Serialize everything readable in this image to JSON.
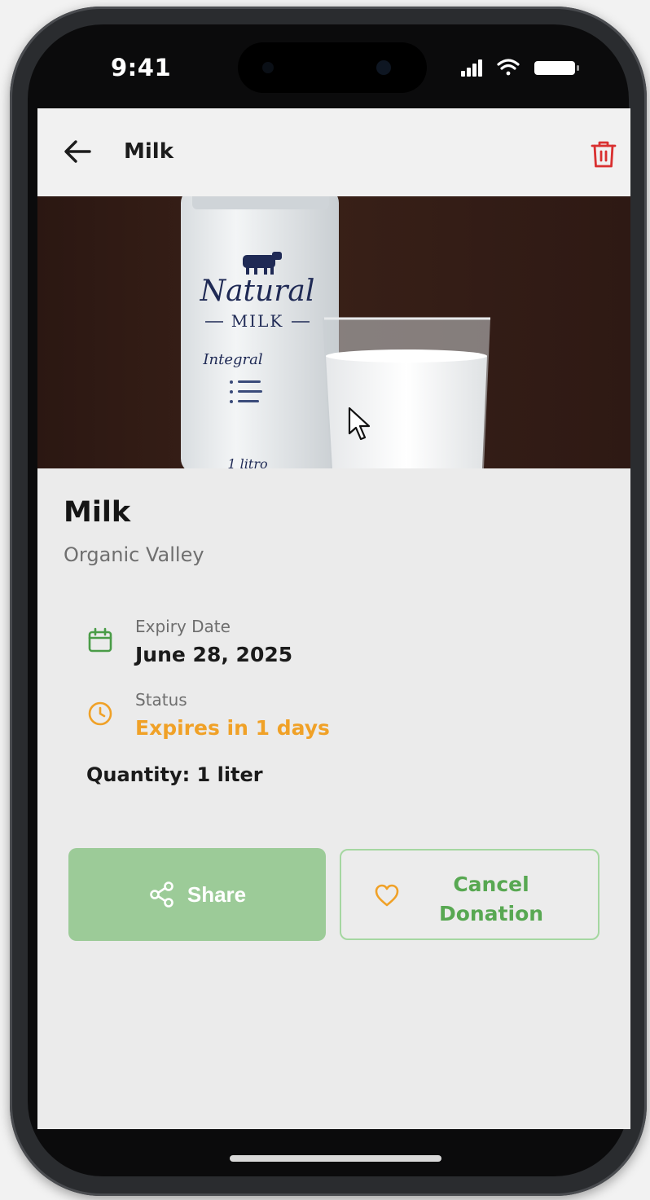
{
  "status_bar": {
    "time": "9:41"
  },
  "app_bar": {
    "title": "Milk"
  },
  "hero": {
    "carton_brand": "Natural",
    "carton_product": "MILK",
    "carton_variant": "Integral",
    "carton_volume": "1 litro"
  },
  "product": {
    "name": "Milk",
    "brand": "Organic Valley"
  },
  "details": {
    "expiry_label": "Expiry Date",
    "expiry_value": "June 28, 2025",
    "status_label": "Status",
    "status_value": "Expires in 1 days",
    "quantity": "Quantity: 1 liter"
  },
  "actions": {
    "share_label": "Share",
    "cancel_line1": "Cancel",
    "cancel_line2": "Donation"
  },
  "colors": {
    "accent_green": "#58a852",
    "share_bg": "#9ccb98",
    "warning_orange": "#f0a127",
    "delete_red": "#d93030"
  },
  "icons": {
    "back": "arrow-left-icon",
    "delete": "trash-icon",
    "expiry": "calendar-icon",
    "status": "clock-icon",
    "share": "share-icon",
    "donation": "heart-icon"
  }
}
